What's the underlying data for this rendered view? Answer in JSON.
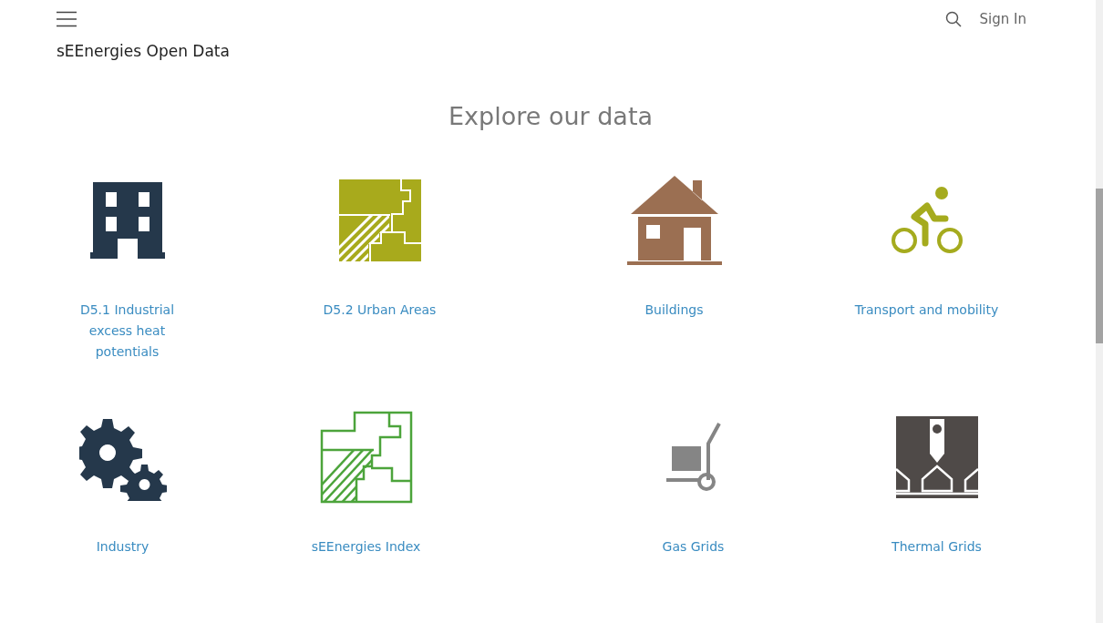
{
  "header": {
    "sign_in": "Sign In"
  },
  "site_title": "sEEnergies Open Data",
  "section_title": "Explore our data",
  "rows": [
    [
      {
        "kind": "building",
        "label": "D5.1 Industrial excess heat potentials"
      },
      {
        "kind": "urban-filled",
        "label": "D5.2 Urban Areas"
      },
      {
        "kind": "house",
        "label": "Buildings"
      },
      {
        "kind": "bicycle",
        "label": "Transport and mobility"
      }
    ],
    [
      {
        "kind": "gears",
        "label": "Industry"
      },
      {
        "kind": "urban-outline",
        "label": "sEEnergies Index"
      },
      {
        "kind": "cart",
        "label": "Gas Grids"
      },
      {
        "kind": "map-pin-houses",
        "label": "Thermal Grids"
      }
    ]
  ]
}
